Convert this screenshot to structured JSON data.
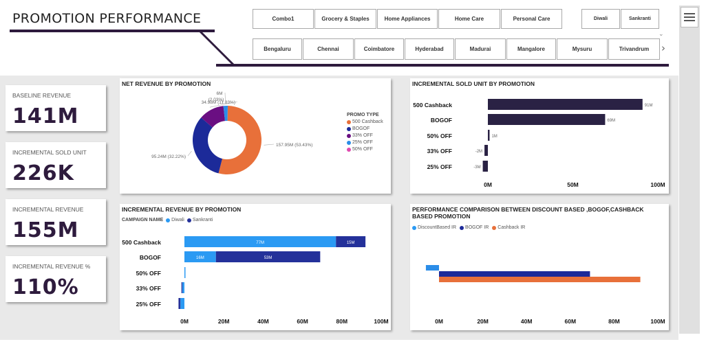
{
  "header": {
    "title": "PROMOTION PERFORMANCE"
  },
  "slicers": {
    "categories": [
      "Combo1",
      "Grocery & Staples",
      "Home Appliances",
      "Home Care",
      "Personal Care"
    ],
    "campaigns": [
      "Diwali",
      "Sankranti"
    ],
    "cities": [
      "Bengaluru",
      "Chennai",
      "Coimbatore",
      "Hyderabad",
      "Madurai",
      "Mangalore",
      "Mysuru",
      "Trivandrum"
    ]
  },
  "kpis": [
    {
      "label": "BASELINE REVENUE",
      "value": "141M"
    },
    {
      "label": "INCREMENTAL SOLD UNIT",
      "value": "226K"
    },
    {
      "label": "INCREMENTAL REVENUE",
      "value": "155M"
    },
    {
      "label": "INCREMENTAL REVENUE %",
      "value": "110%"
    }
  ],
  "colors": {
    "brand": "#2e1b3d",
    "cashback": "#e8703a",
    "bogof": "#1c2a99",
    "off33": "#6a0f82",
    "off25": "#2b8de8",
    "off50": "#e04ab0",
    "diwali": "#2b9af3",
    "sankranti": "#24319a",
    "bar_dark": "#2a2244"
  },
  "chart_data": [
    {
      "type": "pie",
      "title": "NET REVENUE BY PROMOTION",
      "legend_title": "PROMO TYPE",
      "legend_position": "right",
      "categories": [
        "500 Cashback",
        "BOGOF",
        "33% OFF",
        "25% OFF",
        "50% OFF"
      ],
      "values": [
        157.95,
        95.24,
        34.98,
        6,
        0
      ],
      "slice_labels": [
        "157.95M (53.43%)",
        "95.24M (32.22%)",
        "34.98M (11.83%)",
        "6M (2.03%)",
        ""
      ]
    },
    {
      "type": "bar",
      "title": "INCREMENTAL SOLD UNIT BY PROMOTION",
      "orientation": "horizontal",
      "categories": [
        "500 Cashback",
        "BOGOF",
        "50% OFF",
        "33% OFF",
        "25% OFF"
      ],
      "values": [
        91,
        69,
        1,
        -2,
        -3
      ],
      "data_labels": [
        "91M",
        "69M",
        "1M",
        "-2M",
        "-3M"
      ],
      "x_ticks": [
        "0M",
        "50M",
        "100M"
      ],
      "xlim": [
        0,
        100
      ]
    },
    {
      "type": "bar",
      "title": "INCREMENTAL REVENUE BY PROMOTION",
      "orientation": "horizontal",
      "stacked": true,
      "legend_title": "CAMPAIGN NAME",
      "legend_position": "top-left",
      "categories": [
        "500 Cashback",
        "BOGOF",
        "50% OFF",
        "33% OFF",
        "25% OFF"
      ],
      "series": [
        {
          "name": "Diwali",
          "values": [
            77,
            16,
            0.5,
            -1,
            -2
          ],
          "labels": [
            "77M",
            "16M",
            "",
            "",
            ""
          ]
        },
        {
          "name": "Sankranti",
          "values": [
            15,
            53,
            0,
            -0.5,
            -1
          ],
          "labels": [
            "15M",
            "53M",
            "",
            "",
            ""
          ]
        }
      ],
      "x_ticks": [
        "0M",
        "20M",
        "40M",
        "60M",
        "80M",
        "100M"
      ],
      "xlim": [
        0,
        100
      ]
    },
    {
      "type": "bar",
      "title": "PERFORMANCE COMPARISON BETWEEN DISCOUNT BASED ,BOGOF,CASHBACK BASED PROMOTION",
      "orientation": "horizontal",
      "legend_position": "top-left",
      "series": [
        {
          "name": "DiscountBased IR",
          "values": [
            -6
          ]
        },
        {
          "name": "BOGOF IR",
          "values": [
            69
          ]
        },
        {
          "name": "Cashback IR",
          "values": [
            92
          ]
        }
      ],
      "x_ticks": [
        "0M",
        "20M",
        "40M",
        "60M",
        "80M",
        "100M"
      ],
      "xlim": [
        0,
        100
      ]
    }
  ]
}
